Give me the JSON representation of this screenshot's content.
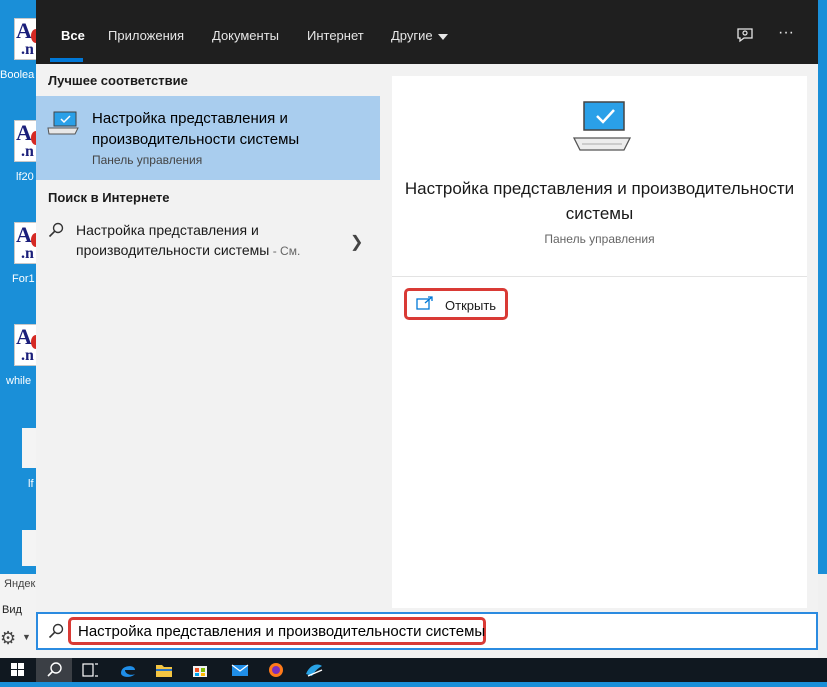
{
  "desktop": {
    "icons": [
      {
        "big": "A",
        "small": ".n",
        "label": "Boolea"
      },
      {
        "big": "A",
        "small": ".n",
        "label": "lf20"
      },
      {
        "big": "A",
        "small": ".n",
        "label": "For1"
      },
      {
        "big": "A",
        "small": ".n",
        "label": "while"
      }
    ],
    "blank_labels": [
      "lf"
    ],
    "peek": {
      "line1": "Яндек",
      "line2": "Вид"
    }
  },
  "tabs": {
    "all": "Все",
    "apps": "Приложения",
    "documents": "Документы",
    "internet": "Интернет",
    "other": "Другие",
    "ellipsis": "···"
  },
  "left": {
    "best_match_heading": "Лучшее соответствие",
    "best_match": {
      "title": "Настройка представления и производительности системы",
      "subtitle": "Панель управления"
    },
    "web_heading": "Поиск в Интернете",
    "web_result": {
      "text": "Настройка представления и производительности системы",
      "more": " - См."
    }
  },
  "right": {
    "title": "Настройка представления и производительности системы",
    "subtitle": "Панель управления",
    "open_label": "Открыть"
  },
  "search": {
    "value": "Настройка представления и производительности системы"
  },
  "colors": {
    "accent": "#0078d7",
    "highlight_box": "#d93a35",
    "selected_bg": "#a9cdee",
    "desktop_bg": "#1a8fd8"
  }
}
